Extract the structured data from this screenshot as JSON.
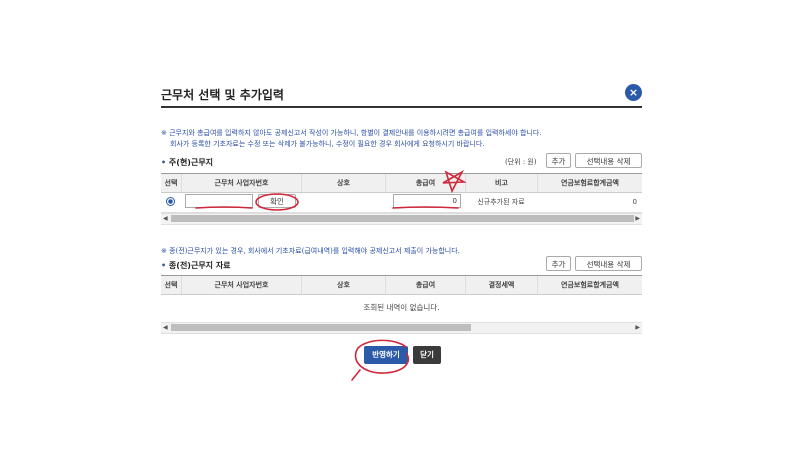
{
  "dialog": {
    "title": "근무처 선택 및 추가입력",
    "close_label": "×"
  },
  "notice1": {
    "line1": "※ 근무지와 총급여를 입력하지 않아도 공제신고서 작성이 가능하니, 항별이 결제안내를 이용하시려면 총급여를 입력하세야 합니다.",
    "line2": "회사가 등록한 기초자료는 수정 또는 삭제가 불가능하니, 수정이 필요한 경우 회사에게 요청하시기 바랍니다."
  },
  "current_section": {
    "title": "주(현)근무지",
    "unit": "(단위 : 원)",
    "add_label": "추가",
    "delete_label": "선택내용 삭제",
    "headers": [
      "선택",
      "근무처 사업자번호",
      "상호",
      "총급여",
      "비고",
      "연금보험료합계금액"
    ],
    "row": {
      "business_no": "",
      "confirm_label": "확인",
      "company": "",
      "total_salary": "0",
      "remark": "신규추가된 자료",
      "pension_total": "0"
    }
  },
  "notice2": {
    "line1": "※ 종(전)근무지가 있는 경우, 회사에서 기초자료(급여내역)를 입력해야 공제신고서 제출이 가능합니다."
  },
  "previous_section": {
    "title": "종(전)근무지 자료",
    "add_label": "추가",
    "delete_label": "선택내용 삭제",
    "headers": [
      "선택",
      "근무처 사업자번호",
      "상호",
      "총급여",
      "결정세액",
      "연금보험료합계금액"
    ],
    "empty_message": "조회된 내역이 없습니다."
  },
  "footer": {
    "apply_label": "반영하기",
    "close_label": "닫기"
  },
  "colors": {
    "primary": "#2b5aa8",
    "annotation": "#d0283a"
  }
}
